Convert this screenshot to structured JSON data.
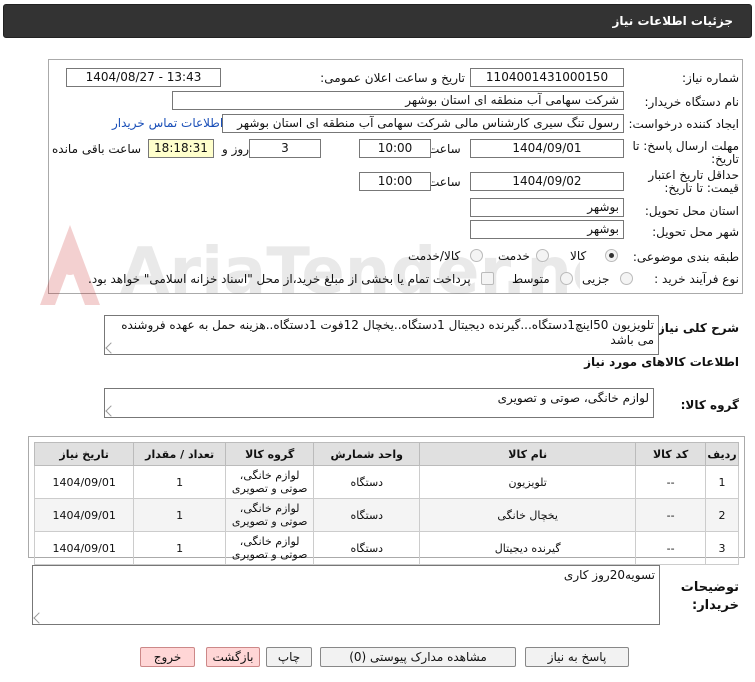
{
  "header": {
    "title": "جزئیات اطلاعات نیاز"
  },
  "fields": {
    "need_number_label": "شماره نیاز:",
    "need_number": "1104001431000150",
    "announce_label": "تاریخ و ساعت اعلان عمومی:",
    "announce_value": "1404/08/27 - 13:43",
    "buyer_label": "نام دستگاه خریدار:",
    "buyer_value": "شرکت سهامی آب منطقه ای استان بوشهر",
    "creator_label": "ایجاد کننده درخواست:",
    "creator_value": "رسول تنگ سیری کارشناس مالی شرکت سهامی آب منطقه ای استان بوشهر",
    "contact_link": "اطلاعات تماس خریدار",
    "deadline_label_1": "مهلت ارسال پاسخ: تا",
    "deadline_label_2": "تاریخ:",
    "deadline_date": "1404/09/01",
    "time_label": "ساعت",
    "deadline_time": "10:00",
    "days_value": "3",
    "days_label": "روز و",
    "remaining_time": "18:18:31",
    "remaining_label": "ساعت باقی مانده",
    "validity_label_1": "حداقل تاریخ اعتبار",
    "validity_label_2": "قیمت: تا تاریخ:",
    "validity_date": "1404/09/02",
    "validity_time": "10:00",
    "province_label": "استان محل تحویل:",
    "province_value": "بوشهر",
    "city_label": "شهر محل تحویل:",
    "city_value": "بوشهر",
    "category_label": "طبقه بندی موضوعی:",
    "cat_goods": "کالا",
    "cat_service": "خدمت",
    "cat_goods_service": "کالا/خدمت",
    "process_label": "نوع فرآیند خرید :",
    "proc_partial": "جزیی",
    "proc_medium": "متوسط",
    "payment_note": "پرداخت تمام یا بخشی از مبلغ خرید،از محل \"اسناد خزانه اسلامی\" خواهد بود."
  },
  "description": {
    "label": "شرح کلی نیاز:",
    "value": "تلویزیون 50اینچ1دستگاه...گیرنده دیجیتال 1دستگاه..یخچال 12فوت 1دستگاه..هزینه حمل به عهده فروشنده می باشد"
  },
  "items_section": {
    "title": "اطلاعات کالاهای مورد نیاز",
    "group_label": "گروه کالا:",
    "group_value": "لوازم خانگی، صوتی و تصویری"
  },
  "table": {
    "headers": [
      "ردیف",
      "کد کالا",
      "نام کالا",
      "واحد شمارش",
      "گروه کالا",
      "تعداد / مقدار",
      "تاریخ نیاز"
    ],
    "rows": [
      [
        "1",
        "--",
        "تلویزیون",
        "دستگاه",
        "لوازم خانگی، صوتی و تصویری",
        "1",
        "1404/09/01"
      ],
      [
        "2",
        "--",
        "یخچال خانگی",
        "دستگاه",
        "لوازم خانگی، صوتی و تصویری",
        "1",
        "1404/09/01"
      ],
      [
        "3",
        "--",
        "گیرنده دیجیتال",
        "دستگاه",
        "لوازم خانگی، صوتی و تصویری",
        "1",
        "1404/09/01"
      ]
    ]
  },
  "buyer_notes": {
    "label_1": "توضیحات",
    "label_2": "خریدار:",
    "value": "تسویه20روز کاری"
  },
  "buttons": {
    "reply": "پاسخ به نیاز",
    "attachments": "مشاهده مدارک پیوستی (0)",
    "print": "چاپ",
    "back": "بازگشت",
    "exit": "خروج"
  },
  "watermark_text": "AriaTender.net",
  "colors": {
    "title_bg": "#333333",
    "highlight": "#ffffcc",
    "link": "#1a4fb8"
  }
}
